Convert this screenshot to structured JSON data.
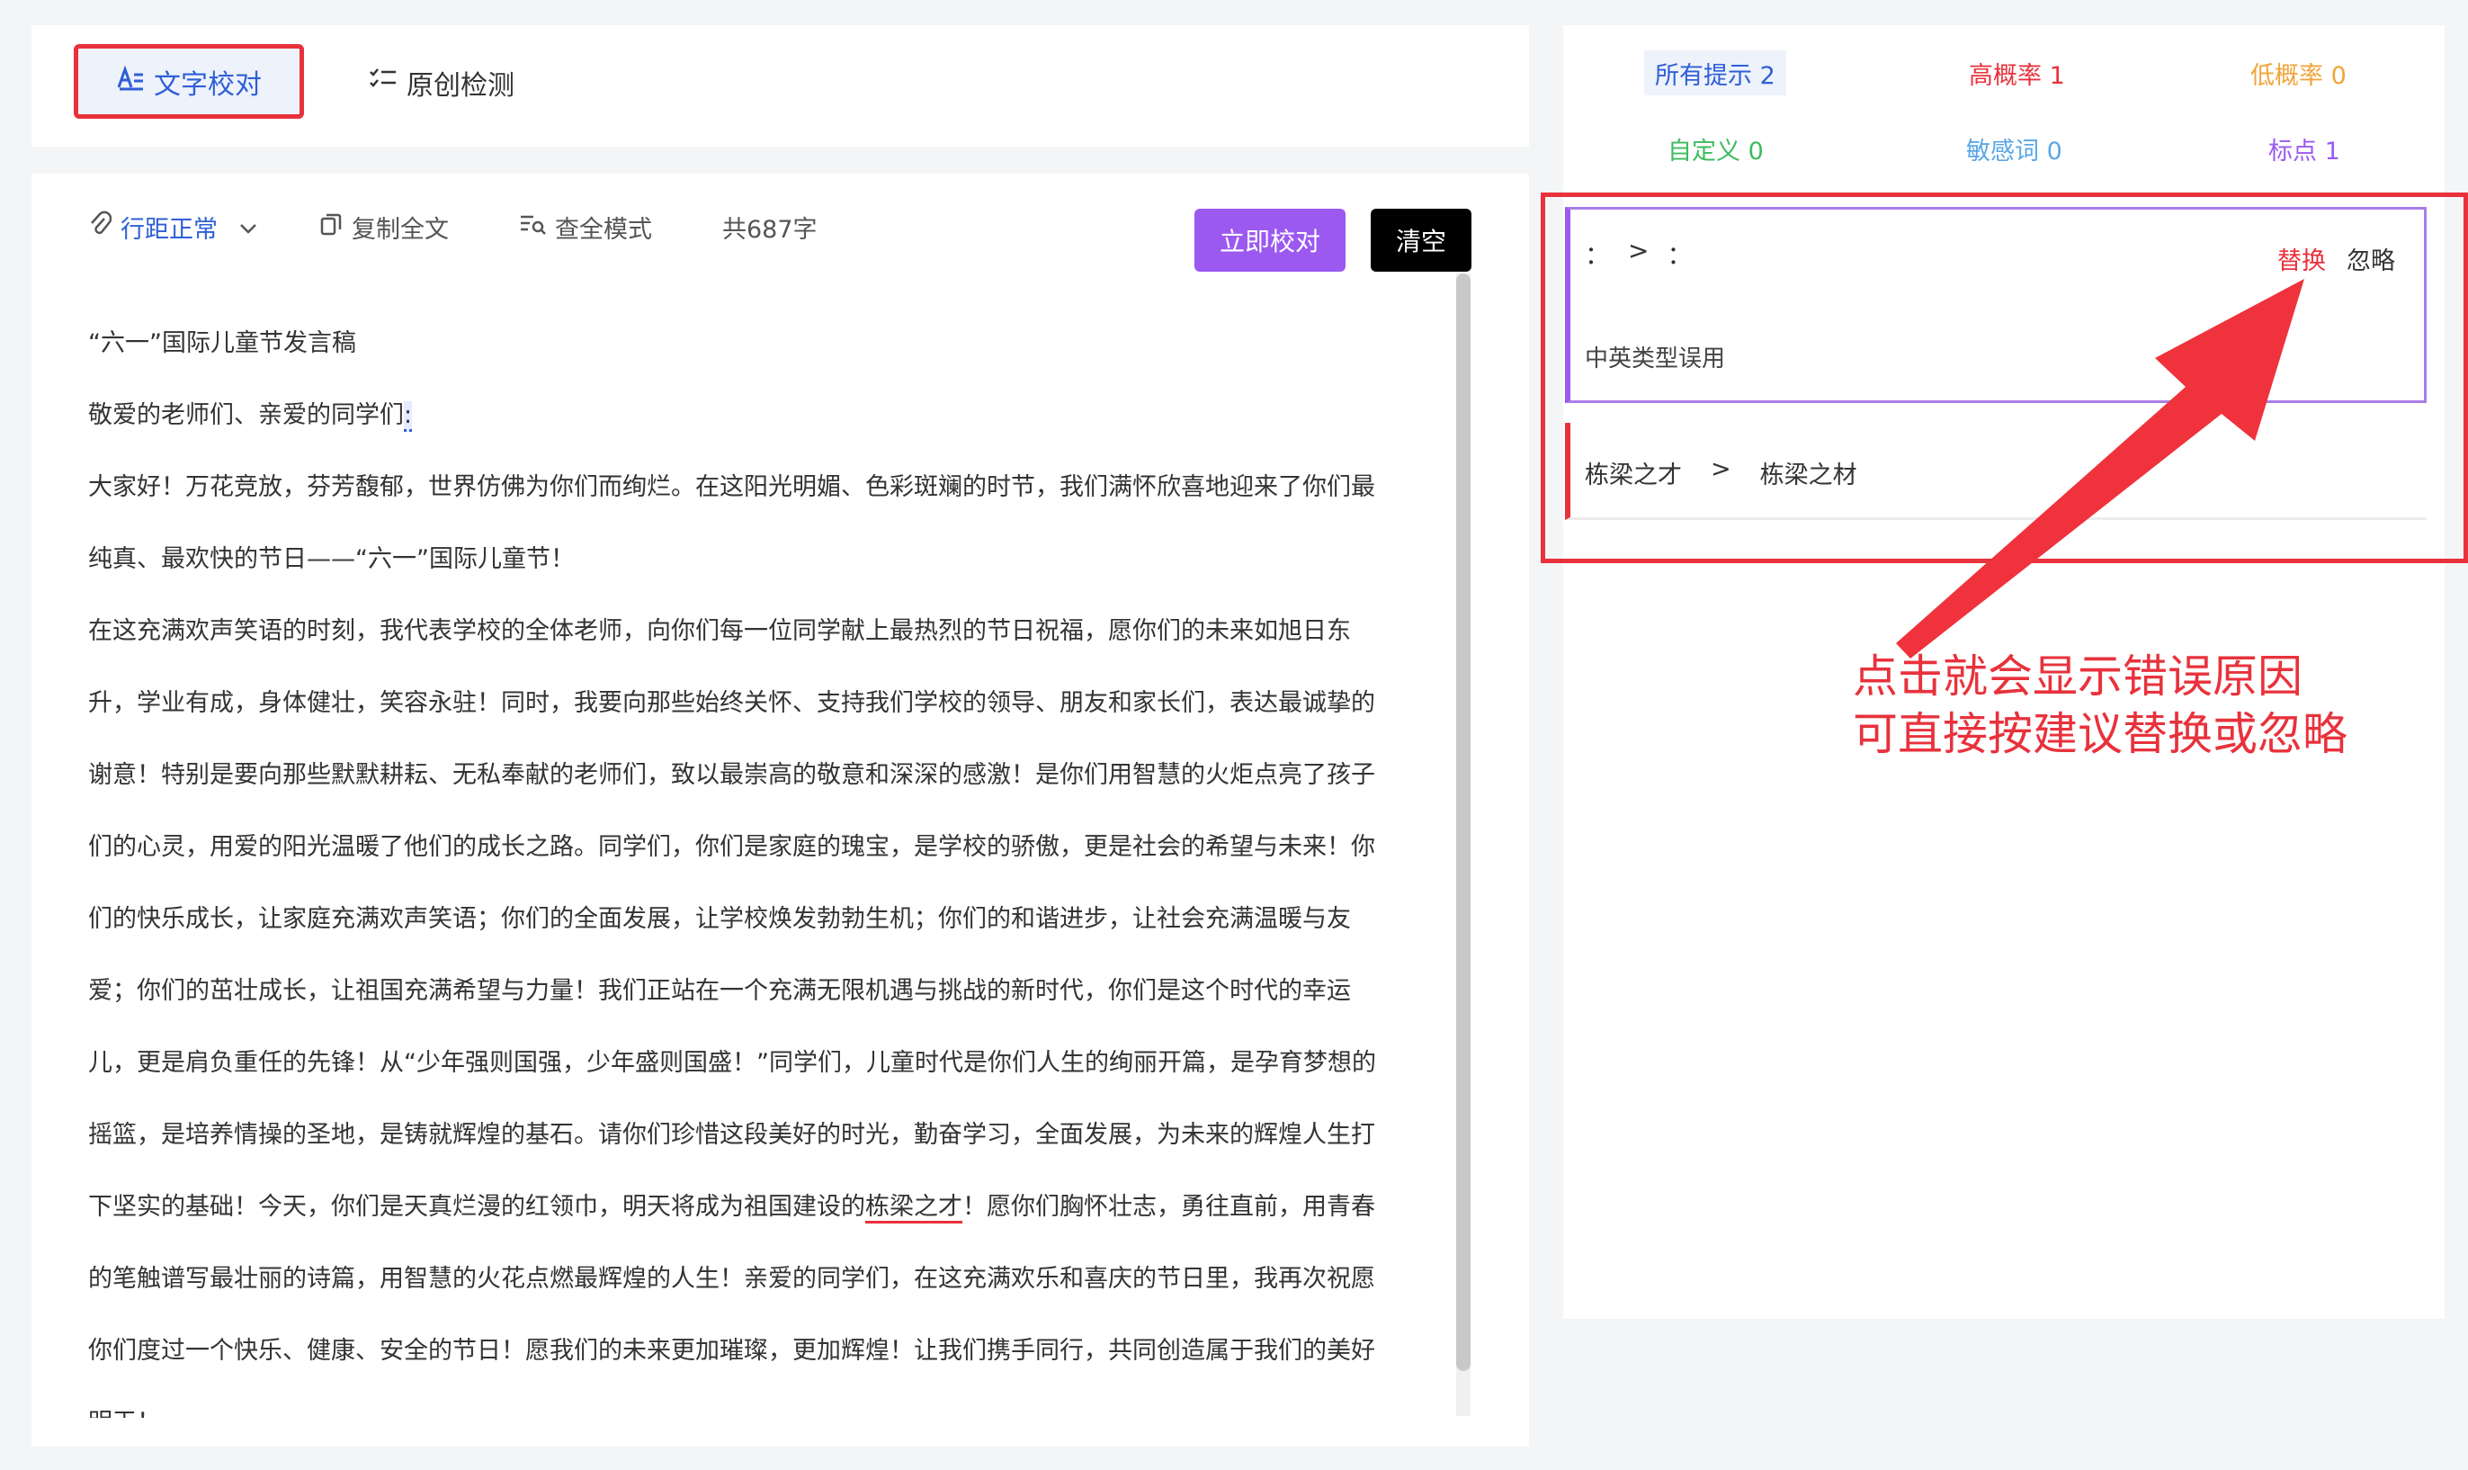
{
  "tabs": {
    "proofread": "文字校对",
    "original_check": "原创检测"
  },
  "toolbar": {
    "line_spacing": "行距正常",
    "copy_all": "复制全文",
    "full_mode": "查全模式",
    "word_count": "共687字",
    "check_now": "立即校对",
    "clear": "清空"
  },
  "document": {
    "paragraphs": [
      "“六一”国际儿童节发言稿",
      "敬爱的老师们、亲爱的同学们",
      "大家好！万花竞放，芬芳馥郁，世界仿佛为你们而绚烂。在这阳光明媚、色彩斑斓的时节，我们满怀欣喜地迎来了你们最",
      "纯真、最欢快的节日——“六一”国际儿童节！",
      "在这充满欢声笑语的时刻，我代表学校的全体老师，向你们每一位同学献上最热烈的节日祝福，愿你们的未来如旭日东",
      "升，学业有成，身体健壮，笑容永驻！同时，我要向那些始终关怀、支持我们学校的领导、朋友和家长们，表达最诚挚的",
      "谢意！特别是要向那些默默耕耘、无私奉献的老师们，致以最崇高的敬意和深深的感激！是你们用智慧的火炬点亮了孩子",
      "们的心灵，用爱的阳光温暖了他们的成长之路。同学们，你们是家庭的瑰宝，是学校的骄傲，更是社会的希望与未来！你",
      "们的快乐成长，让家庭充满欢声笑语；你们的全面发展，让学校焕发勃勃生机；你们的和谐进步，让社会充满温暖与友",
      "爱；你们的茁壮成长，让祖国充满希望与力量！我们正站在一个充满无限机遇与挑战的新时代，你们是这个时代的幸运",
      "儿，更是肩负重任的先锋！从“少年强则国强，少年盛则国盛！”同学们，儿童时代是你们人生的绚丽开篇，是孕育梦想的",
      "摇篮，是培养情操的圣地，是铸就辉煌的基石。请你们珍惜这段美好的时光，勤奋学习，全面发展，为未来的辉煌人生打",
      "下坚实的基础！今天，你们是天真烂漫的红领巾，明天将成为祖国建设的",
      "的笔触谱写最壮丽的诗篇，用智慧的火花点燃最辉煌的人生！亲爱的同学们，在这充满欢乐和喜庆的节日里，我再次祝愿",
      "你们度过一个快乐、健康、安全的节日！愿我们的未来更加璀璨，更加辉煌！让我们携手同行，共同创造属于我们的美好",
      "明天！"
    ],
    "mark_colon": ":",
    "mark_error": "栋梁之才",
    "line13_tail": "！愿你们胸怀壮志，勇往直前，用青春"
  },
  "filters": {
    "all": "所有提示 2",
    "high": "高概率 1",
    "low": "低概率 0",
    "custom": "自定义 0",
    "sensitive": "敏感词 0",
    "punct": "标点 1"
  },
  "suggestions": [
    {
      "from": "：",
      "arrow": ">",
      "to": "：",
      "replace": "替换",
      "ignore": "忽略",
      "reason": "中英类型误用"
    },
    {
      "from": "栋梁之才",
      "arrow": ">",
      "to": "栋梁之材"
    }
  ],
  "annotation": {
    "line1": "点击就会显示错误原因",
    "line2": "可直接按建议替换或忽略"
  },
  "colors": {
    "accent_blue": "#2f5fd6",
    "accent_purple": "#9b59f0",
    "error_red": "#e8323c",
    "low_orange": "#f0a43a",
    "custom_green": "#3dbb5e",
    "sensitive_blue": "#5aa7e8"
  }
}
